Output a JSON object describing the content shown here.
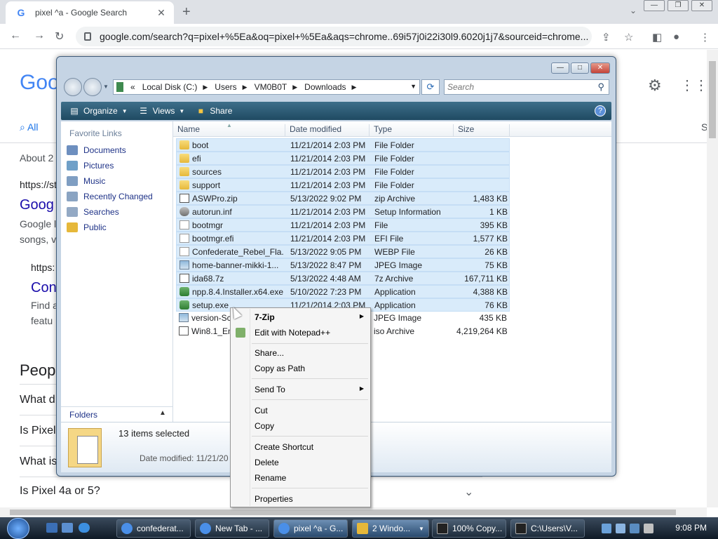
{
  "chrome": {
    "tab_title": "pixel ^a - Google Search",
    "favicon": "G",
    "new_tab": "+",
    "tab_close": "✕",
    "url": "google.com/search?q=pixel+%5Ea&oq=pixel+%5Ea&aqs=chrome..69i57j0i22i30l9.6020j1j7&sourceid=chrome..."
  },
  "google": {
    "logo": "Goo",
    "tab_all": "All",
    "about": "About 2",
    "result1_url": "https://st",
    "result1_title": "Goog",
    "result1_snip1": "Google l",
    "result1_snip2": "songs, v",
    "result2_url": "https:",
    "result2_title": "Con",
    "result2_snip1": "Find a",
    "result2_snip2": "featu",
    "people_heading": "Peop",
    "q1": "What d",
    "q2": "Is Pixel",
    "q3": "What is",
    "q4": "Is Pixel 4a or 5?",
    "right_s": "S"
  },
  "explorer": {
    "address": [
      "Local Disk (C:)",
      "Users",
      "VM0B0T",
      "Downloads"
    ],
    "address_prefix": "«",
    "search_placeholder": "Search",
    "toolbar": {
      "organize": "Organize",
      "views": "Views",
      "share": "Share"
    },
    "nav_header": "Favorite Links",
    "nav": [
      "Documents",
      "Pictures",
      "Music",
      "Recently Changed",
      "Searches",
      "Public"
    ],
    "folders_label": "Folders",
    "columns": {
      "name": "Name",
      "date": "Date modified",
      "type": "Type",
      "size": "Size"
    },
    "files": [
      {
        "name": "boot",
        "date": "11/21/2014 2:03 PM",
        "type": "File Folder",
        "size": "",
        "icon": "folder-icon"
      },
      {
        "name": "efi",
        "date": "11/21/2014 2:03 PM",
        "type": "File Folder",
        "size": "",
        "icon": "folder-icon"
      },
      {
        "name": "sources",
        "date": "11/21/2014 2:03 PM",
        "type": "File Folder",
        "size": "",
        "icon": "folder-icon"
      },
      {
        "name": "support",
        "date": "11/21/2014 2:03 PM",
        "type": "File Folder",
        "size": "",
        "icon": "folder-icon"
      },
      {
        "name": "ASWPro.zip",
        "date": "5/13/2022 9:02 PM",
        "type": "zip Archive",
        "size": "1,483 KB",
        "icon": "zip-icon"
      },
      {
        "name": "autorun.inf",
        "date": "11/21/2014 2:03 PM",
        "type": "Setup Information",
        "size": "1 KB",
        "icon": "setup-info-icon"
      },
      {
        "name": "bootmgr",
        "date": "11/21/2014 2:03 PM",
        "type": "File",
        "size": "395 KB",
        "icon": "file-icon"
      },
      {
        "name": "bootmgr.efi",
        "date": "11/21/2014 2:03 PM",
        "type": "EFI File",
        "size": "1,577 KB",
        "icon": "file-icon"
      },
      {
        "name": "Confederate_Rebel_Fla...",
        "date": "5/13/2022 9:05 PM",
        "type": "WEBP File",
        "size": "26 KB",
        "icon": "file-icon"
      },
      {
        "name": "home-banner-mikki-1...",
        "date": "5/13/2022 8:47 PM",
        "type": "JPEG Image",
        "size": "75 KB",
        "icon": "image-icon"
      },
      {
        "name": "ida68.7z",
        "date": "5/13/2022 4:48 AM",
        "type": "7z Archive",
        "size": "167,711 KB",
        "icon": "zip-icon"
      },
      {
        "name": "npp.8.4.Installer.x64.exe",
        "date": "5/10/2022 7:23 PM",
        "type": "Application",
        "size": "4,388 KB",
        "icon": "exe-icon"
      },
      {
        "name": "setup.exe",
        "date": "11/21/2014 2:03 PM",
        "type": "Application",
        "size": "76 KB",
        "icon": "exe-icon"
      },
      {
        "name": "version-Sc",
        "date": "",
        "type": "JPEG Image",
        "size": "435 KB",
        "icon": "image-icon"
      },
      {
        "name": "Win8.1_En",
        "date": "",
        "type": "iso Archive",
        "size": "4,219,264 KB",
        "icon": "iso-icon"
      }
    ],
    "details_count": "13 items selected",
    "details_date": "Date modified: 11/21/20"
  },
  "context_menu": {
    "items": [
      "7-Zip",
      "Edit with Notepad++",
      "Share...",
      "Copy as Path",
      "Send To",
      "Cut",
      "Copy",
      "Create Shortcut",
      "Delete",
      "Rename",
      "Properties"
    ]
  },
  "taskbar": {
    "buttons": [
      "confederat...",
      "New Tab - ...",
      "pixel ^a - G...",
      "2 Windo...",
      "100% Copy...",
      "C:\\Users\\V..."
    ],
    "clock": "9:08 PM"
  }
}
